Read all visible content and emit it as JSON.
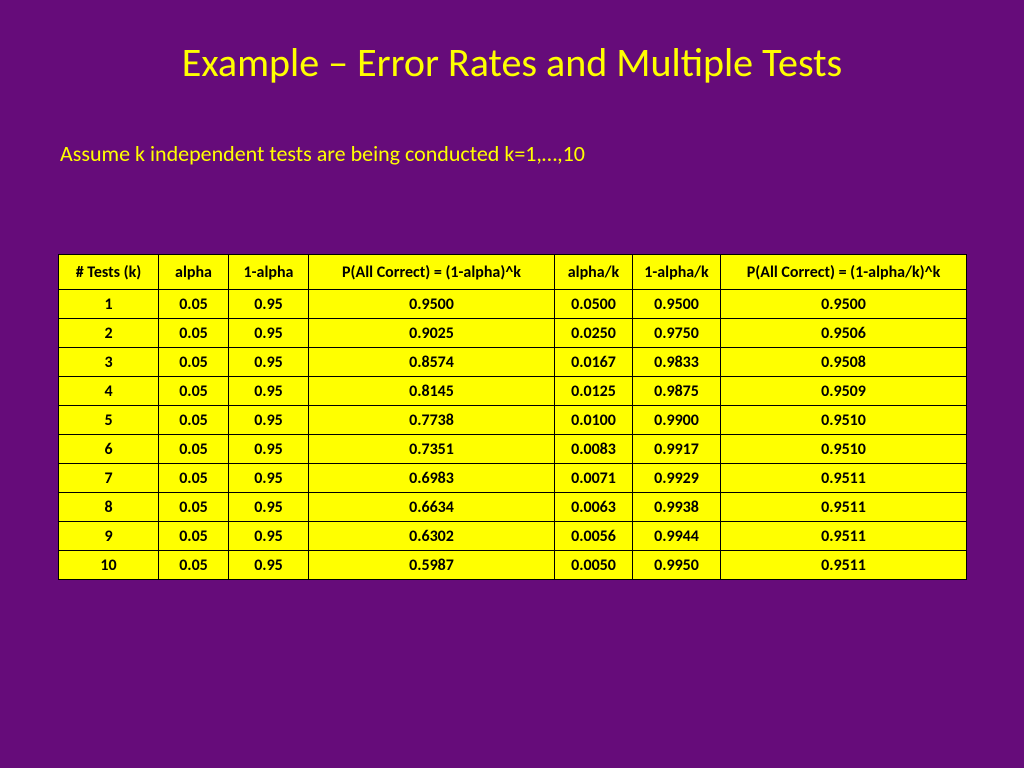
{
  "title": "Example – Error Rates and Multiple Tests",
  "subtitle": "Assume k independent tests are being conducted   k=1,…,10",
  "table": {
    "headers": [
      "# Tests (k)",
      "alpha",
      "1-alpha",
      "P(All Correct) = (1-alpha)^k",
      "alpha/k",
      "1-alpha/k",
      "P(All Correct) = (1-alpha/k)^k"
    ],
    "rows": [
      [
        "1",
        "0.05",
        "0.95",
        "0.9500",
        "0.0500",
        "0.9500",
        "0.9500"
      ],
      [
        "2",
        "0.05",
        "0.95",
        "0.9025",
        "0.0250",
        "0.9750",
        "0.9506"
      ],
      [
        "3",
        "0.05",
        "0.95",
        "0.8574",
        "0.0167",
        "0.9833",
        "0.9508"
      ],
      [
        "4",
        "0.05",
        "0.95",
        "0.8145",
        "0.0125",
        "0.9875",
        "0.9509"
      ],
      [
        "5",
        "0.05",
        "0.95",
        "0.7738",
        "0.0100",
        "0.9900",
        "0.9510"
      ],
      [
        "6",
        "0.05",
        "0.95",
        "0.7351",
        "0.0083",
        "0.9917",
        "0.9510"
      ],
      [
        "7",
        "0.05",
        "0.95",
        "0.6983",
        "0.0071",
        "0.9929",
        "0.9511"
      ],
      [
        "8",
        "0.05",
        "0.95",
        "0.6634",
        "0.0063",
        "0.9938",
        "0.9511"
      ],
      [
        "9",
        "0.05",
        "0.95",
        "0.6302",
        "0.0056",
        "0.9944",
        "0.9511"
      ],
      [
        "10",
        "0.05",
        "0.95",
        "0.5987",
        "0.0050",
        "0.9950",
        "0.9511"
      ]
    ]
  },
  "chart_data": {
    "type": "table",
    "title": "Example – Error Rates and Multiple Tests",
    "columns": [
      "# Tests (k)",
      "alpha",
      "1-alpha",
      "P(All Correct) = (1-alpha)^k",
      "alpha/k",
      "1-alpha/k",
      "P(All Correct) = (1-alpha/k)^k"
    ],
    "rows": [
      [
        1,
        0.05,
        0.95,
        0.95,
        0.05,
        0.95,
        0.95
      ],
      [
        2,
        0.05,
        0.95,
        0.9025,
        0.025,
        0.975,
        0.9506
      ],
      [
        3,
        0.05,
        0.95,
        0.8574,
        0.0167,
        0.9833,
        0.9508
      ],
      [
        4,
        0.05,
        0.95,
        0.8145,
        0.0125,
        0.9875,
        0.9509
      ],
      [
        5,
        0.05,
        0.95,
        0.7738,
        0.01,
        0.99,
        0.951
      ],
      [
        6,
        0.05,
        0.95,
        0.7351,
        0.0083,
        0.9917,
        0.951
      ],
      [
        7,
        0.05,
        0.95,
        0.6983,
        0.0071,
        0.9929,
        0.9511
      ],
      [
        8,
        0.05,
        0.95,
        0.6634,
        0.0063,
        0.9938,
        0.9511
      ],
      [
        9,
        0.05,
        0.95,
        0.6302,
        0.0056,
        0.9944,
        0.9511
      ],
      [
        10,
        0.05,
        0.95,
        0.5987,
        0.005,
        0.995,
        0.9511
      ]
    ]
  }
}
